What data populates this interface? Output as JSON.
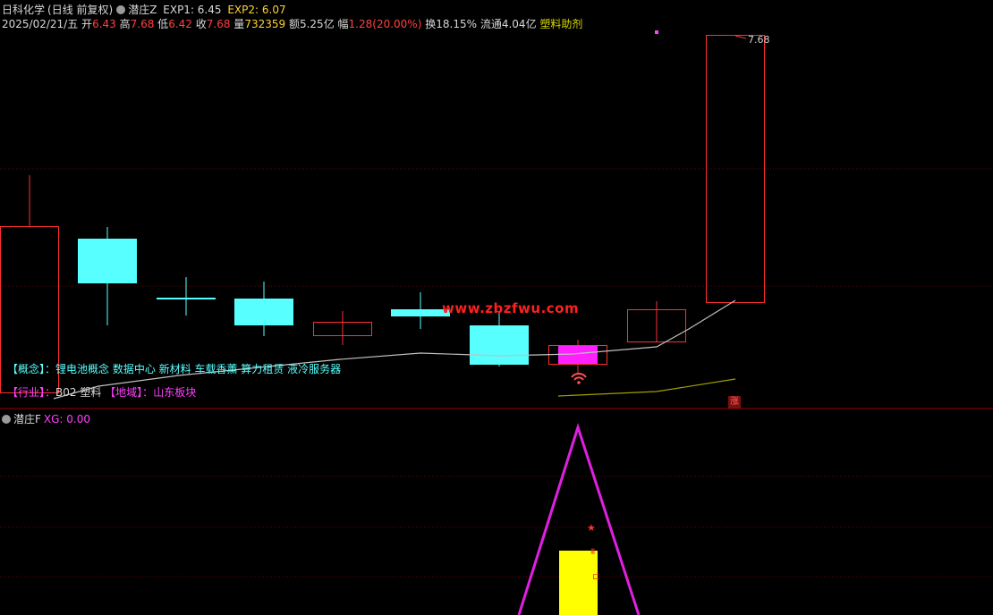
{
  "header": {
    "stock_name": "日科化学",
    "period": "(日线 前复权)",
    "indicator_name": "潜庄Z",
    "exp1": "EXP1: 6.45",
    "exp2": "EXP2: 6.07",
    "date": "2025/02/21/五",
    "open_label": "开",
    "open_value": "6.43",
    "high_label": "高",
    "high_value": "7.68",
    "low_label": "低",
    "low_value": "6.42",
    "close_label": "收",
    "close_value": "7.68",
    "volume_label": "量",
    "volume_value": "732359",
    "amount_label": "额",
    "amount_value": "5.25亿",
    "change_label": "幅",
    "change_value": "1.28(20.00%)",
    "turnover_label": "换",
    "turnover_value": "18.15%",
    "float_label": "流通",
    "float_value": "4.04亿",
    "sector_tag": "塑料助剂"
  },
  "chart": {
    "price_high_label": "7.68",
    "watermark": "www.zbzfwu.com",
    "limit_badge": "涨"
  },
  "info": {
    "concept_label": "【概念】：",
    "concept_text": "锂电池概念 数据中心 新材料 车载香薰 算力租赁 液冷服务器",
    "industry_label": "【行业】：",
    "industry_text": "B02 塑料",
    "region_label": "【地域】：",
    "region_text": "山东板块"
  },
  "lower": {
    "indicator_name": "潜庄F",
    "xg_text": "XG: 0.00"
  },
  "colors": {
    "up": "#ff3030",
    "down": "#58ffff",
    "highlight": "#ff20ff",
    "ma_line": "#c0c0c0",
    "ma_line2": "#a0a000",
    "grid": "#6a0000",
    "osc_triangle": "#e020e0",
    "osc_bar": "#ffff00"
  }
}
